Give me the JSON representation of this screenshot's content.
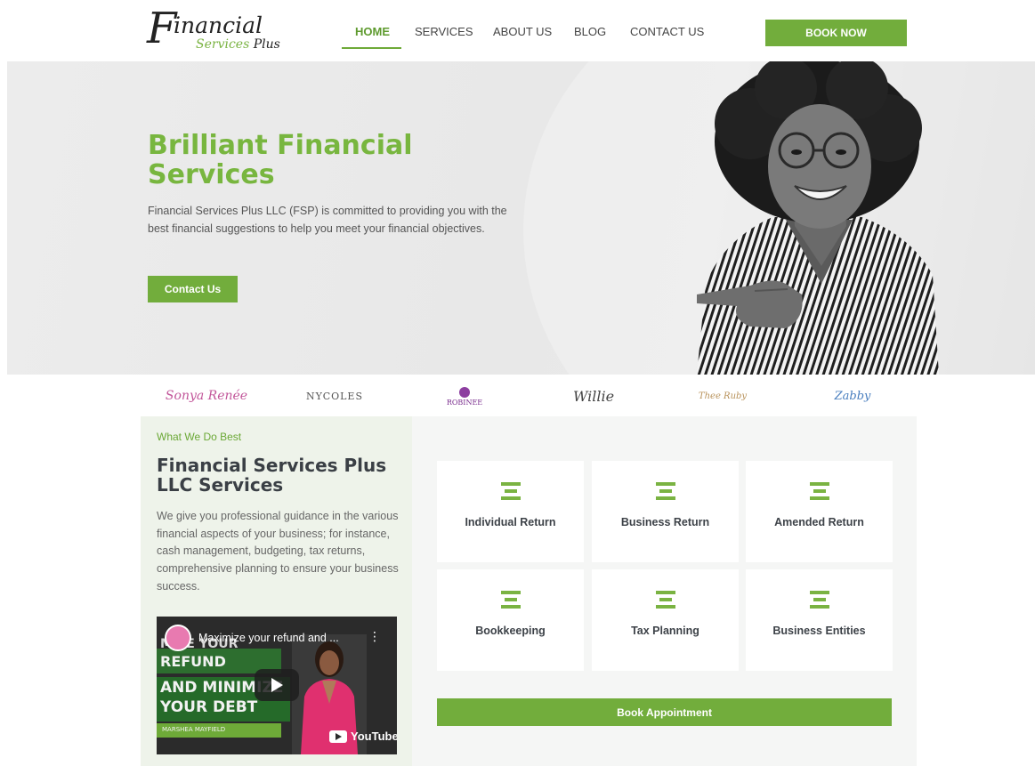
{
  "logo": {
    "initial": "F",
    "top": "inancial",
    "bottom1": "Services",
    "bottom2": "Plus"
  },
  "nav": {
    "items": [
      "HOME",
      "SERVICES",
      "ABOUT US",
      "BLOG",
      "CONTACT US"
    ],
    "active": "HOME",
    "cta": "BOOK NOW"
  },
  "hero": {
    "title": "Brilliant Financial Services",
    "text": "Financial Services Plus LLC (FSP) is committed to providing you with the best financial suggestions to help you meet your financial objectives.",
    "button": "Contact Us"
  },
  "partners": [
    "Sonya Renée",
    "NYCOLES",
    "ROBINEE",
    "Willie",
    "Thee Ruby",
    "Zabby"
  ],
  "services": {
    "eyebrow": "What We Do Best",
    "title": "Financial Services Plus LLC Services",
    "description": "We give you professional guidance in the various financial aspects of your business; for instance, cash management, budgeting, tax returns, comprehensive planning to ensure your business success.",
    "cards": [
      "Individual Return",
      "Business Return",
      "Amended Return",
      "Bookkeeping",
      "Tax Planning",
      "Business Entities"
    ],
    "button": "Book Appointment"
  },
  "video": {
    "title": "Maximize your refund and ...",
    "overlay_line1": "MIZE YOUR",
    "overlay_line2": "REFUND",
    "overlay_line3": "AND MINIMIZE",
    "overlay_line4": "YOUR DEBT",
    "overlay_name": "MARSHEA MAYFIELD",
    "platform": "YouTube"
  },
  "colors": {
    "brand_green": "#72ad3c",
    "heading_green": "#78b63f",
    "dark_text": "#3a3f45"
  }
}
